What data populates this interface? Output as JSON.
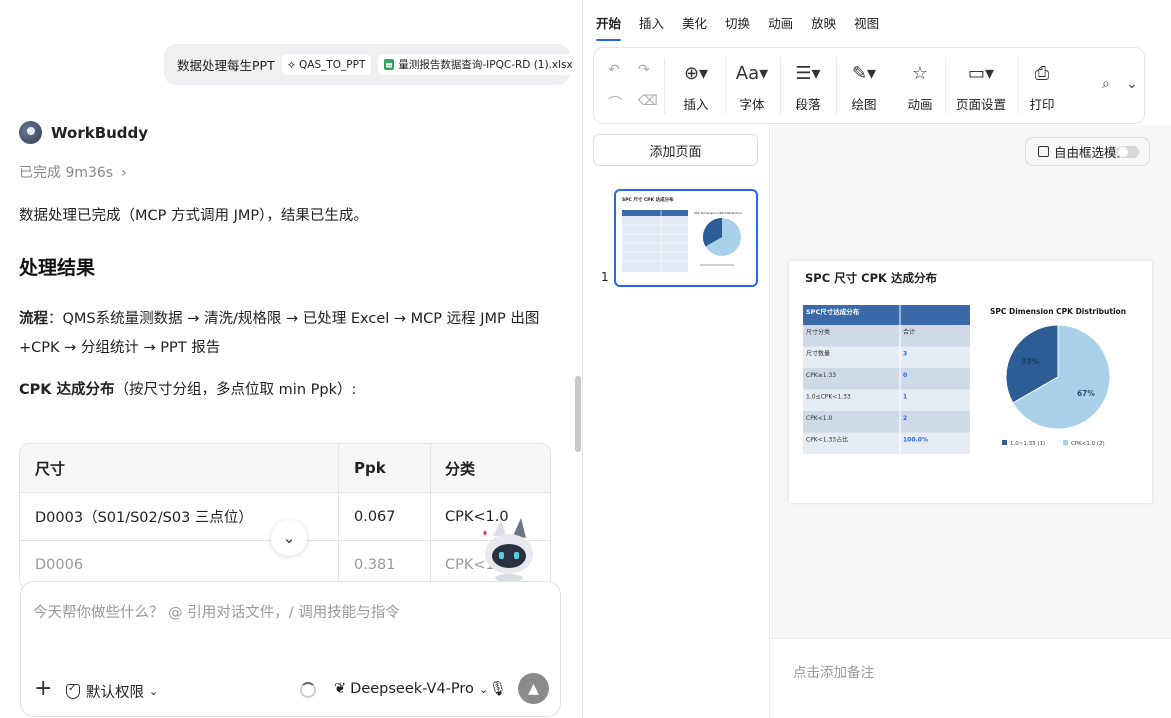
{
  "chat": {
    "user_message": {
      "text": "数据处理每生PPT",
      "skill_chip": "QAS_TO_PPT",
      "file_chip": "量测报告数据查询-IPQC-RD (1).xlsx"
    },
    "bot": {
      "name": "WorkBuddy",
      "status": "已完成 9m36s",
      "summary": "数据处理已完成（MCP 方式调用 JMP），结果已生成。",
      "heading": "处理结果",
      "flow_label": "流程",
      "flow_text": "：QMS系统量测数据 → 清洗/规格限 → 已处理 Excel → MCP 远程 JMP 出图+CPK → 分组统计 → PPT 报告",
      "cpk_label": "CPK 达成分布",
      "cpk_text": "（按尺寸分组，多点位取 min Ppk）:"
    },
    "table": {
      "headers": [
        "尺寸",
        "Ppk",
        "分类"
      ],
      "rows": [
        [
          "D0003（S01/S02/S03 三点位）",
          "0.067",
          "CPK<1.0"
        ],
        [
          "D0006",
          "0.381",
          "CPK<1"
        ]
      ]
    },
    "composer": {
      "placeholder": "今天帮你做些什么？ @ 引用对话文件，/ 调用技能与指令",
      "permission": "默认权限",
      "model": "Deepseek-V4-Pro"
    }
  },
  "ppt": {
    "menu": [
      "开始",
      "插入",
      "美化",
      "切换",
      "动画",
      "放映",
      "视图"
    ],
    "active_menu": "开始",
    "ribbon": [
      "插入",
      "字体",
      "段落",
      "绘图",
      "动画",
      "页面设置",
      "打印"
    ],
    "add_page": "添加页面",
    "free_mode": "自由框选模式",
    "slide_number": "1",
    "notes_placeholder": "点击添加备注",
    "slide": {
      "title": "SPC 尺寸 CPK 达成分布",
      "table_header": "SPC尺寸达成分布",
      "table_rows": [
        [
          "尺寸分类",
          "合计"
        ],
        [
          "尺寸数量",
          "3"
        ],
        [
          "CPK≥1.33",
          "0"
        ],
        [
          "1.0≤CPK<1.33",
          "1"
        ],
        [
          "CPK<1.0",
          "2"
        ],
        [
          "CPK<1.33占比",
          "100.0%"
        ]
      ]
    },
    "colors": {
      "accent": "#2468f2",
      "table_header": "#3b6aa8",
      "pie_dark": "#2c5d94",
      "pie_light": "#a9d1ea"
    }
  },
  "chart_data": {
    "type": "pie",
    "title": "SPC Dimension CPK Distribution",
    "labels": [
      "1.0~1.33 (1)",
      "CPK<1.0 (2)"
    ],
    "values": [
      1,
      2
    ],
    "slice_labels": [
      "33%",
      "67%"
    ],
    "legend": "bottom"
  }
}
